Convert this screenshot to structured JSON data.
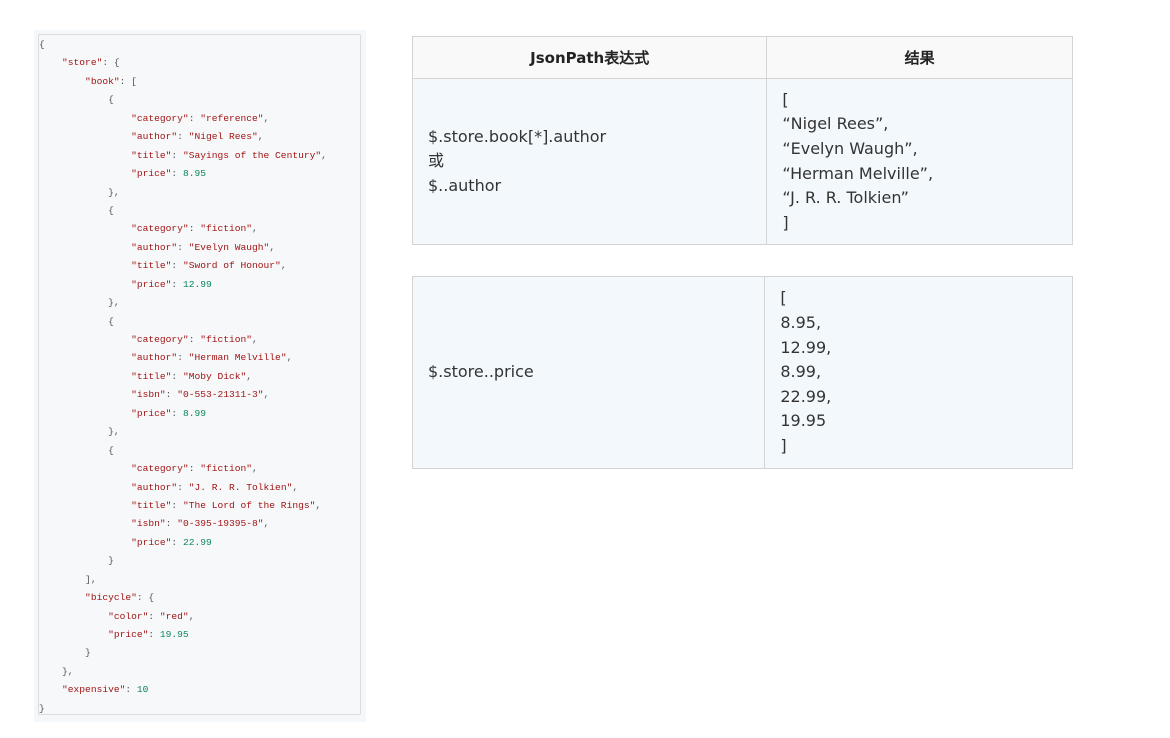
{
  "code_lines": [
    [
      [
        "pun",
        "{"
      ]
    ],
    [
      [
        "key",
        "    \"store\""
      ],
      [
        "pun",
        ": {"
      ]
    ],
    [
      [
        "key",
        "        \"book\""
      ],
      [
        "pun",
        ": ["
      ]
    ],
    [
      [
        "pun",
        "            {"
      ]
    ],
    [
      [
        "key",
        "                \"category\""
      ],
      [
        "pun",
        ": "
      ],
      [
        "str",
        "\"reference\""
      ],
      [
        "pun",
        ","
      ]
    ],
    [
      [
        "key",
        "                \"author\""
      ],
      [
        "pun",
        ": "
      ],
      [
        "str",
        "\"Nigel Rees\""
      ],
      [
        "pun",
        ","
      ]
    ],
    [
      [
        "key",
        "                \"title\""
      ],
      [
        "pun",
        ": "
      ],
      [
        "str",
        "\"Sayings of the Century\""
      ],
      [
        "pun",
        ","
      ]
    ],
    [
      [
        "key",
        "                \"price\""
      ],
      [
        "pun",
        ": "
      ],
      [
        "num",
        "8.95"
      ]
    ],
    [
      [
        "pun",
        "            },"
      ]
    ],
    [
      [
        "pun",
        "            {"
      ]
    ],
    [
      [
        "key",
        "                \"category\""
      ],
      [
        "pun",
        ": "
      ],
      [
        "str",
        "\"fiction\""
      ],
      [
        "pun",
        ","
      ]
    ],
    [
      [
        "key",
        "                \"author\""
      ],
      [
        "pun",
        ": "
      ],
      [
        "str",
        "\"Evelyn Waugh\""
      ],
      [
        "pun",
        ","
      ]
    ],
    [
      [
        "key",
        "                \"title\""
      ],
      [
        "pun",
        ": "
      ],
      [
        "str",
        "\"Sword of Honour\""
      ],
      [
        "pun",
        ","
      ]
    ],
    [
      [
        "key",
        "                \"price\""
      ],
      [
        "pun",
        ": "
      ],
      [
        "num",
        "12.99"
      ]
    ],
    [
      [
        "pun",
        "            },"
      ]
    ],
    [
      [
        "pun",
        "            {"
      ]
    ],
    [
      [
        "key",
        "                \"category\""
      ],
      [
        "pun",
        ": "
      ],
      [
        "str",
        "\"fiction\""
      ],
      [
        "pun",
        ","
      ]
    ],
    [
      [
        "key",
        "                \"author\""
      ],
      [
        "pun",
        ": "
      ],
      [
        "str",
        "\"Herman Melville\""
      ],
      [
        "pun",
        ","
      ]
    ],
    [
      [
        "key",
        "                \"title\""
      ],
      [
        "pun",
        ": "
      ],
      [
        "str",
        "\"Moby Dick\""
      ],
      [
        "pun",
        ","
      ]
    ],
    [
      [
        "key",
        "                \"isbn\""
      ],
      [
        "pun",
        ": "
      ],
      [
        "str",
        "\"0-553-21311-3\""
      ],
      [
        "pun",
        ","
      ]
    ],
    [
      [
        "key",
        "                \"price\""
      ],
      [
        "pun",
        ": "
      ],
      [
        "num",
        "8.99"
      ]
    ],
    [
      [
        "pun",
        "            },"
      ]
    ],
    [
      [
        "pun",
        "            {"
      ]
    ],
    [
      [
        "key",
        "                \"category\""
      ],
      [
        "pun",
        ": "
      ],
      [
        "str",
        "\"fiction\""
      ],
      [
        "pun",
        ","
      ]
    ],
    [
      [
        "key",
        "                \"author\""
      ],
      [
        "pun",
        ": "
      ],
      [
        "str",
        "\"J. R. R. Tolkien\""
      ],
      [
        "pun",
        ","
      ]
    ],
    [
      [
        "key",
        "                \"title\""
      ],
      [
        "pun",
        ": "
      ],
      [
        "str",
        "\"The Lord of the Rings\""
      ],
      [
        "pun",
        ","
      ]
    ],
    [
      [
        "key",
        "                \"isbn\""
      ],
      [
        "pun",
        ": "
      ],
      [
        "str",
        "\"0-395-19395-8\""
      ],
      [
        "pun",
        ","
      ]
    ],
    [
      [
        "key",
        "                \"price\""
      ],
      [
        "pun",
        ": "
      ],
      [
        "num",
        "22.99"
      ]
    ],
    [
      [
        "pun",
        "            }"
      ]
    ],
    [
      [
        "pun",
        "        ],"
      ]
    ],
    [
      [
        "key",
        "        \"bicycle\""
      ],
      [
        "pun",
        ": {"
      ]
    ],
    [
      [
        "key",
        "            \"color\""
      ],
      [
        "pun",
        ": "
      ],
      [
        "str",
        "\"red\""
      ],
      [
        "pun",
        ","
      ]
    ],
    [
      [
        "key",
        "            \"price\""
      ],
      [
        "pun",
        ": "
      ],
      [
        "num",
        "19.95"
      ]
    ],
    [
      [
        "pun",
        "        }"
      ]
    ],
    [
      [
        "pun",
        "    },"
      ]
    ],
    [
      [
        "key",
        "    \"expensive\""
      ],
      [
        "pun",
        ": "
      ],
      [
        "num",
        "10"
      ]
    ],
    [
      [
        "pun",
        "}"
      ]
    ]
  ],
  "table1": {
    "header_expr": "JsonPath表达式",
    "header_result": "结果",
    "expr_lines": [
      "$.store.book[*].author",
      "或",
      "$..author"
    ],
    "result_lines": [
      "[",
      "“Nigel Rees”,",
      "“Evelyn Waugh”,",
      "“Herman Melville”,",
      "“J. R. R. Tolkien”",
      "]"
    ]
  },
  "table2": {
    "expr_lines": [
      "$.store..price"
    ],
    "result_lines": [
      "[",
      "8.95,",
      "12.99,",
      "8.99,",
      "22.99,",
      "19.95",
      "]"
    ]
  }
}
